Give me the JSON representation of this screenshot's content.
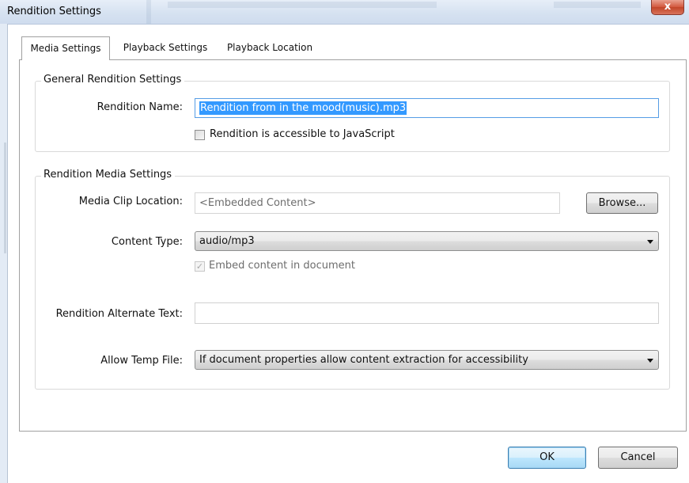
{
  "window": {
    "title": "Rendition Settings",
    "close_glyph": "x"
  },
  "tabs": [
    {
      "label": "Media Settings",
      "active": true
    },
    {
      "label": "Playback Settings",
      "active": false
    },
    {
      "label": "Playback Location",
      "active": false
    }
  ],
  "general": {
    "legend": "General Rendition Settings",
    "rendition_name_label": "Rendition Name:",
    "rendition_name_value": "Rendition from in the mood(music).mp3",
    "js_accessible_label": "Rendition is accessible to JavaScript",
    "js_accessible_checked": false
  },
  "media": {
    "legend": "Rendition Media Settings",
    "clip_location_label": "Media Clip Location:",
    "clip_location_value": "<Embedded Content>",
    "browse_label": "Browse...",
    "content_type_label": "Content Type:",
    "content_type_value": "audio/mp3",
    "embed_label": "Embed content in document",
    "embed_checked": true,
    "embed_checkmark": "✓",
    "alt_text_label": "Rendition Alternate Text:",
    "alt_text_value": "",
    "temp_file_label": "Allow Temp File:",
    "temp_file_value": "If document properties allow content extraction for accessibility"
  },
  "buttons": {
    "ok": "OK",
    "cancel": "Cancel"
  },
  "colors": {
    "selection": "#3399ff",
    "focus_border": "#569de5",
    "close_button": "#c24528"
  }
}
